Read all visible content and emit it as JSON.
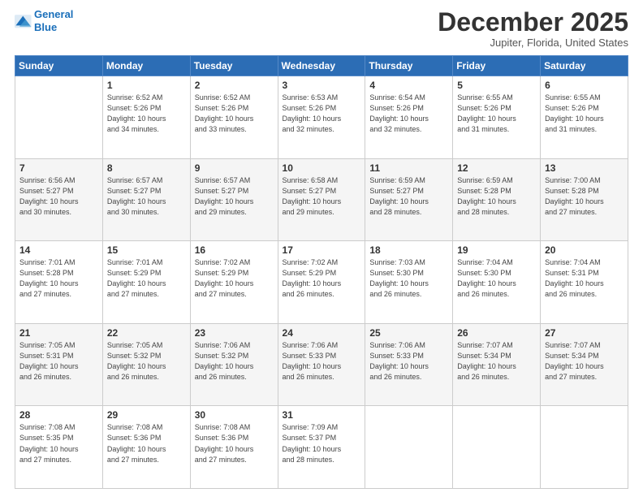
{
  "header": {
    "logo_line1": "General",
    "logo_line2": "Blue",
    "title": "December 2025",
    "location": "Jupiter, Florida, United States"
  },
  "days_of_week": [
    "Sunday",
    "Monday",
    "Tuesday",
    "Wednesday",
    "Thursday",
    "Friday",
    "Saturday"
  ],
  "weeks": [
    [
      {
        "day": "",
        "info": ""
      },
      {
        "day": "1",
        "info": "Sunrise: 6:52 AM\nSunset: 5:26 PM\nDaylight: 10 hours\nand 34 minutes."
      },
      {
        "day": "2",
        "info": "Sunrise: 6:52 AM\nSunset: 5:26 PM\nDaylight: 10 hours\nand 33 minutes."
      },
      {
        "day": "3",
        "info": "Sunrise: 6:53 AM\nSunset: 5:26 PM\nDaylight: 10 hours\nand 32 minutes."
      },
      {
        "day": "4",
        "info": "Sunrise: 6:54 AM\nSunset: 5:26 PM\nDaylight: 10 hours\nand 32 minutes."
      },
      {
        "day": "5",
        "info": "Sunrise: 6:55 AM\nSunset: 5:26 PM\nDaylight: 10 hours\nand 31 minutes."
      },
      {
        "day": "6",
        "info": "Sunrise: 6:55 AM\nSunset: 5:26 PM\nDaylight: 10 hours\nand 31 minutes."
      }
    ],
    [
      {
        "day": "7",
        "info": "Sunrise: 6:56 AM\nSunset: 5:27 PM\nDaylight: 10 hours\nand 30 minutes."
      },
      {
        "day": "8",
        "info": "Sunrise: 6:57 AM\nSunset: 5:27 PM\nDaylight: 10 hours\nand 30 minutes."
      },
      {
        "day": "9",
        "info": "Sunrise: 6:57 AM\nSunset: 5:27 PM\nDaylight: 10 hours\nand 29 minutes."
      },
      {
        "day": "10",
        "info": "Sunrise: 6:58 AM\nSunset: 5:27 PM\nDaylight: 10 hours\nand 29 minutes."
      },
      {
        "day": "11",
        "info": "Sunrise: 6:59 AM\nSunset: 5:27 PM\nDaylight: 10 hours\nand 28 minutes."
      },
      {
        "day": "12",
        "info": "Sunrise: 6:59 AM\nSunset: 5:28 PM\nDaylight: 10 hours\nand 28 minutes."
      },
      {
        "day": "13",
        "info": "Sunrise: 7:00 AM\nSunset: 5:28 PM\nDaylight: 10 hours\nand 27 minutes."
      }
    ],
    [
      {
        "day": "14",
        "info": "Sunrise: 7:01 AM\nSunset: 5:28 PM\nDaylight: 10 hours\nand 27 minutes."
      },
      {
        "day": "15",
        "info": "Sunrise: 7:01 AM\nSunset: 5:29 PM\nDaylight: 10 hours\nand 27 minutes."
      },
      {
        "day": "16",
        "info": "Sunrise: 7:02 AM\nSunset: 5:29 PM\nDaylight: 10 hours\nand 27 minutes."
      },
      {
        "day": "17",
        "info": "Sunrise: 7:02 AM\nSunset: 5:29 PM\nDaylight: 10 hours\nand 26 minutes."
      },
      {
        "day": "18",
        "info": "Sunrise: 7:03 AM\nSunset: 5:30 PM\nDaylight: 10 hours\nand 26 minutes."
      },
      {
        "day": "19",
        "info": "Sunrise: 7:04 AM\nSunset: 5:30 PM\nDaylight: 10 hours\nand 26 minutes."
      },
      {
        "day": "20",
        "info": "Sunrise: 7:04 AM\nSunset: 5:31 PM\nDaylight: 10 hours\nand 26 minutes."
      }
    ],
    [
      {
        "day": "21",
        "info": "Sunrise: 7:05 AM\nSunset: 5:31 PM\nDaylight: 10 hours\nand 26 minutes."
      },
      {
        "day": "22",
        "info": "Sunrise: 7:05 AM\nSunset: 5:32 PM\nDaylight: 10 hours\nand 26 minutes."
      },
      {
        "day": "23",
        "info": "Sunrise: 7:06 AM\nSunset: 5:32 PM\nDaylight: 10 hours\nand 26 minutes."
      },
      {
        "day": "24",
        "info": "Sunrise: 7:06 AM\nSunset: 5:33 PM\nDaylight: 10 hours\nand 26 minutes."
      },
      {
        "day": "25",
        "info": "Sunrise: 7:06 AM\nSunset: 5:33 PM\nDaylight: 10 hours\nand 26 minutes."
      },
      {
        "day": "26",
        "info": "Sunrise: 7:07 AM\nSunset: 5:34 PM\nDaylight: 10 hours\nand 26 minutes."
      },
      {
        "day": "27",
        "info": "Sunrise: 7:07 AM\nSunset: 5:34 PM\nDaylight: 10 hours\nand 27 minutes."
      }
    ],
    [
      {
        "day": "28",
        "info": "Sunrise: 7:08 AM\nSunset: 5:35 PM\nDaylight: 10 hours\nand 27 minutes."
      },
      {
        "day": "29",
        "info": "Sunrise: 7:08 AM\nSunset: 5:36 PM\nDaylight: 10 hours\nand 27 minutes."
      },
      {
        "day": "30",
        "info": "Sunrise: 7:08 AM\nSunset: 5:36 PM\nDaylight: 10 hours\nand 27 minutes."
      },
      {
        "day": "31",
        "info": "Sunrise: 7:09 AM\nSunset: 5:37 PM\nDaylight: 10 hours\nand 28 minutes."
      },
      {
        "day": "",
        "info": ""
      },
      {
        "day": "",
        "info": ""
      },
      {
        "day": "",
        "info": ""
      }
    ]
  ]
}
